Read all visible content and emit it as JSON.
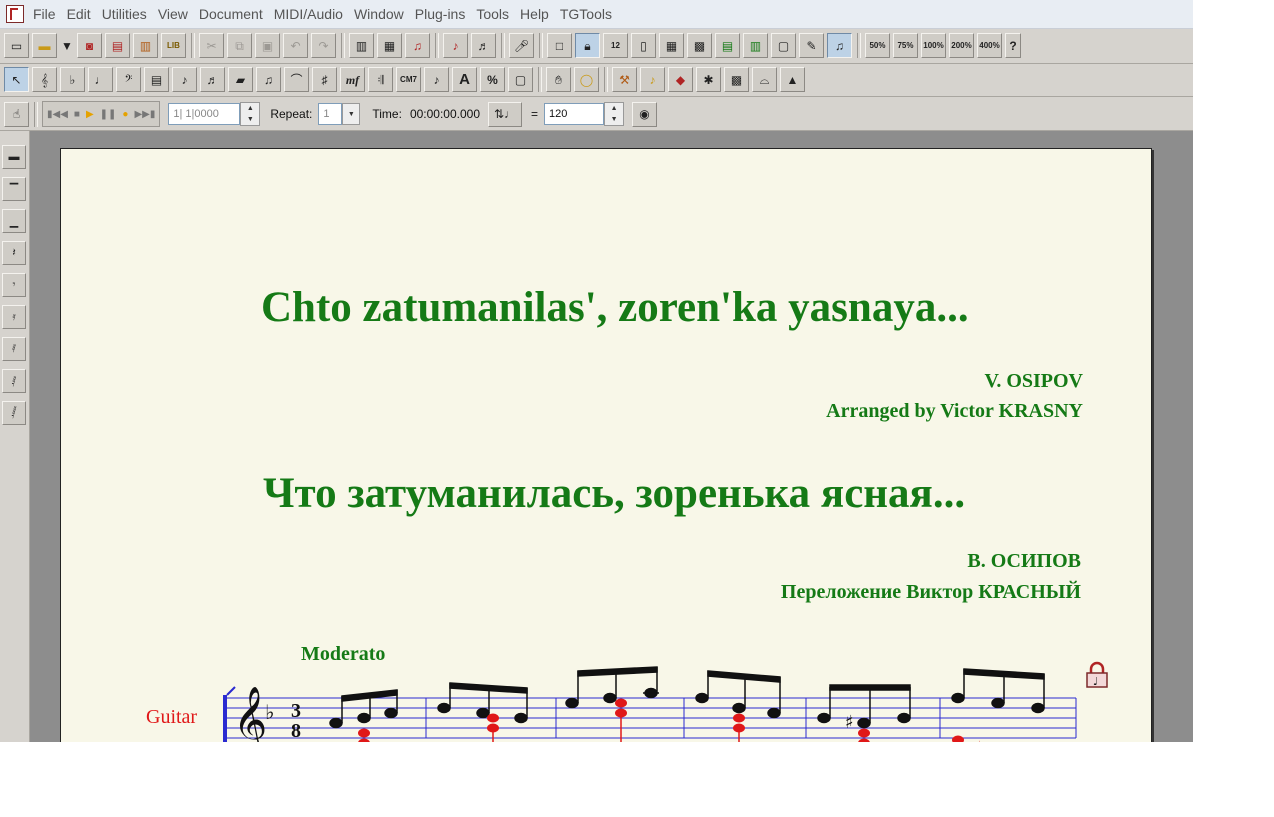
{
  "menubar": {
    "items": [
      "File",
      "Edit",
      "Utilities",
      "View",
      "Document",
      "MIDI/Audio",
      "Window",
      "Plug-ins",
      "Tools",
      "Help",
      "TGTools"
    ]
  },
  "toolbar1": {
    "zoom_presets": [
      "50%",
      "75%",
      "100%",
      "200%",
      "400%"
    ],
    "help_glyph": "?"
  },
  "toolbar2": {
    "chord_symbol": "CM7",
    "dynamic": "mf",
    "text_tool": "A",
    "percent_tool": "%"
  },
  "playback": {
    "counter": "1| 1|0000",
    "repeat_label": "Repeat:",
    "repeat_value": "1",
    "time_label": "Time:",
    "time_value": "00:00:00.000",
    "equals": "=",
    "tempo_value": "120"
  },
  "score": {
    "title_latin": "Chto zatumanilas', zoren'ka yasnaya...",
    "composer_latin": "V. OSIPOV",
    "arranger_latin": "Arranged by Victor KRASNY",
    "title_cyrillic": "Что затуманилась, зоренька ясная...",
    "composer_cyrillic": "В. ОСИПОВ",
    "arranger_cyrillic": "Переложение Виктор КРАСНЫЙ",
    "tempo_marking": "Moderato",
    "instrument": "Guitar",
    "time_signature_top": "3",
    "time_signature_bottom": "8",
    "key_signature": "♭"
  },
  "colors": {
    "title_green": "#157a16",
    "instrument_red": "#e01818",
    "staff_blue": "#2a2ad0",
    "paper": "#f8f7e8"
  }
}
